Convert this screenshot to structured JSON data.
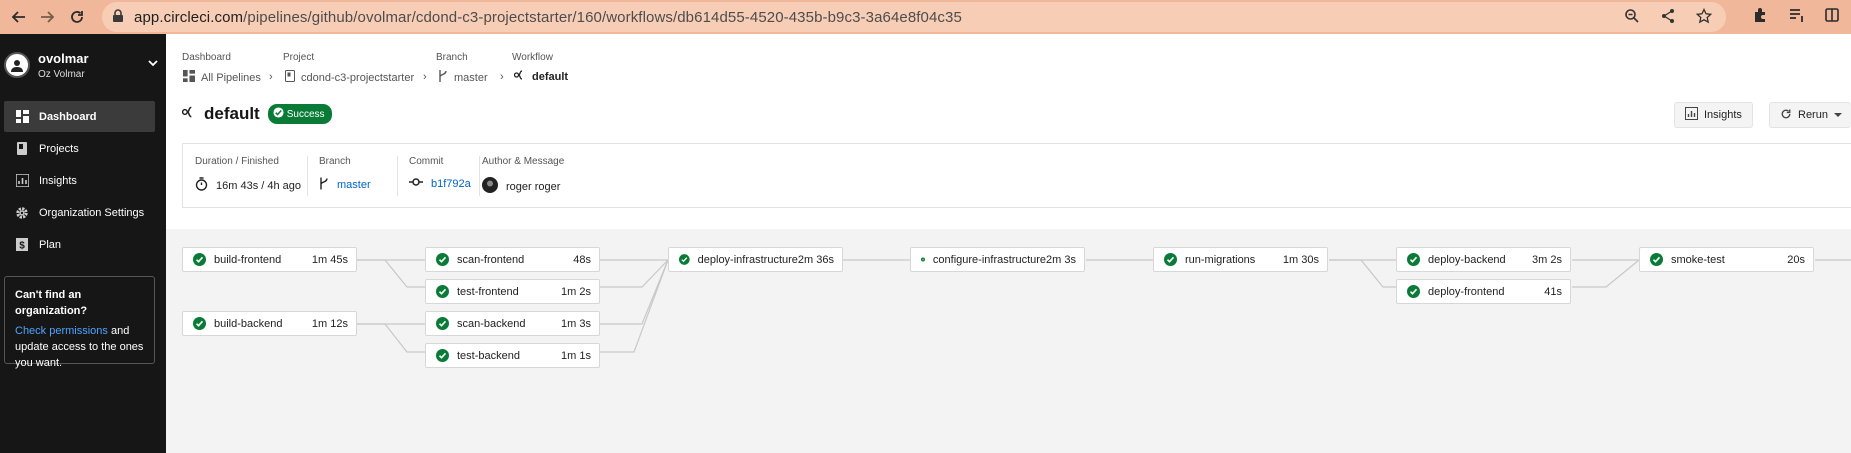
{
  "browser": {
    "url_host": "app.circleci.com",
    "url_path": "/pipelines/github/ovolmar/cdond-c3-projectstarter/160/workflows/db614d55-4520-435b-b9c3-3a64e8f04c35"
  },
  "sidebar": {
    "org_name": "ovolmar",
    "user_name": "Oz Volmar",
    "items": [
      {
        "label": "Dashboard",
        "icon": "dashboard-icon"
      },
      {
        "label": "Projects",
        "icon": "book-icon"
      },
      {
        "label": "Insights",
        "icon": "chart-icon"
      },
      {
        "label": "Organization Settings",
        "icon": "gear-icon"
      },
      {
        "label": "Plan",
        "icon": "dollar-icon"
      }
    ],
    "help": {
      "title": "Can't find an organization?",
      "link": "Check permissions",
      "rest": " and update access to the ones you want."
    }
  },
  "breadcrumb": {
    "dashboard_label": "Dashboard",
    "dashboard_value": "All Pipelines",
    "project_label": "Project",
    "project_value": "cdond-c3-projectstarter",
    "branch_label": "Branch",
    "branch_value": "master",
    "workflow_label": "Workflow",
    "workflow_value": "default"
  },
  "header": {
    "title": "default",
    "status": "Success",
    "insights_button": "Insights",
    "rerun_button": "Rerun"
  },
  "meta": {
    "duration_label": "Duration / Finished",
    "duration_value": "16m 43s / 4h ago",
    "branch_label": "Branch",
    "branch_value": "master",
    "commit_label": "Commit",
    "commit_value": "b1f792a",
    "author_label": "Author & Message",
    "author_value": "roger roger"
  },
  "jobs": [
    {
      "name": "build-frontend",
      "duration": "1m 45s"
    },
    {
      "name": "build-backend",
      "duration": "1m 12s"
    },
    {
      "name": "scan-frontend",
      "duration": "48s"
    },
    {
      "name": "test-frontend",
      "duration": "1m 2s"
    },
    {
      "name": "scan-backend",
      "duration": "1m 3s"
    },
    {
      "name": "test-backend",
      "duration": "1m 1s"
    },
    {
      "name": "deploy-infrastructure",
      "duration": "2m 36s"
    },
    {
      "name": "configure-infrastructure",
      "duration": "2m 3s"
    },
    {
      "name": "run-migrations",
      "duration": "1m 30s"
    },
    {
      "name": "deploy-backend",
      "duration": "3m 2s"
    },
    {
      "name": "deploy-frontend",
      "duration": "41s"
    },
    {
      "name": "smoke-test",
      "duration": "20s"
    }
  ],
  "colors": {
    "success": "#0a7b37",
    "link": "#0063c6",
    "sidebar": "#161616"
  }
}
